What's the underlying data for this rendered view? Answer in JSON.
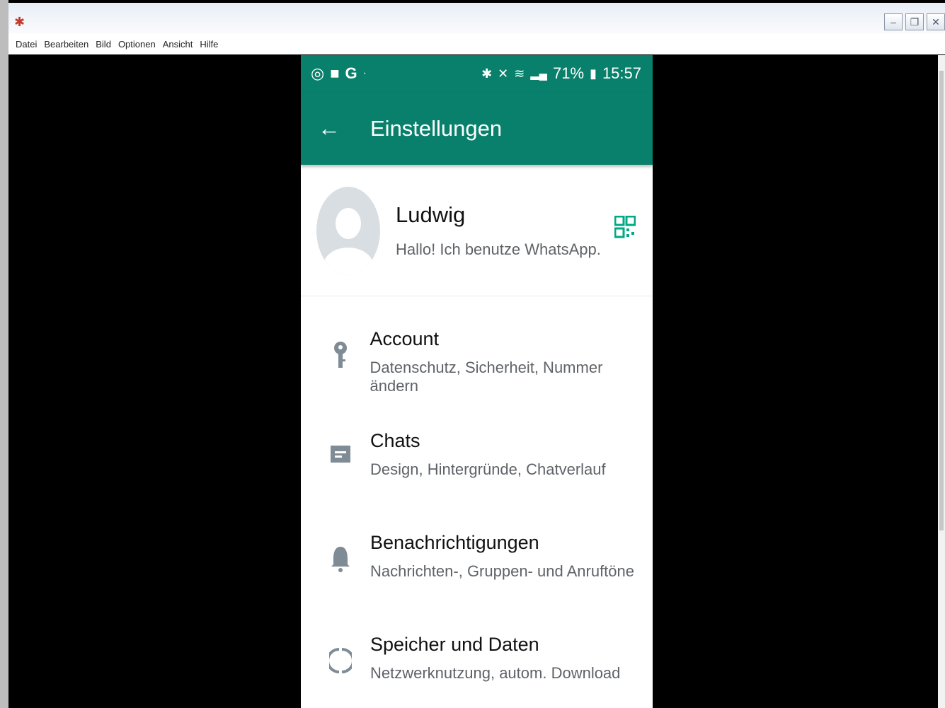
{
  "window": {
    "app_icon": "bug-icon",
    "buttons": [
      "minimize-icon",
      "restore-icon",
      "close-icon"
    ]
  },
  "menu": [
    "Datei",
    "Bearbeiten",
    "Bild",
    "Optionen",
    "Ansicht",
    "Hilfe"
  ],
  "phone": {
    "statusbar": {
      "left_icons": [
        "sync-icon",
        "message-icon",
        "google-icon",
        "dot"
      ],
      "battery": "71%",
      "time": "15:57"
    },
    "appbar": {
      "title": "Einstellungen"
    },
    "profile": {
      "name": "Ludwig",
      "status": "Hallo! Ich benutze WhatsApp."
    },
    "items": [
      {
        "title": "Account",
        "subtitle": "Datenschutz, Sicherheit, Nummer ändern",
        "icon": "key-icon"
      },
      {
        "title": "Chats",
        "subtitle": "Design, Hintergründe, Chatverlauf",
        "icon": "chat-icon"
      },
      {
        "title": "Benachrichtigungen",
        "subtitle": "Nachrichten-, Gruppen- und Anruftöne",
        "icon": "bell-icon"
      },
      {
        "title": "Speicher und Daten",
        "subtitle": "Netzwerknutzung, autom. Download",
        "icon": "data-usage-icon"
      }
    ],
    "colors": {
      "primary": "#08806b",
      "icon": "#7f8b95",
      "accent": "#00a884"
    }
  }
}
